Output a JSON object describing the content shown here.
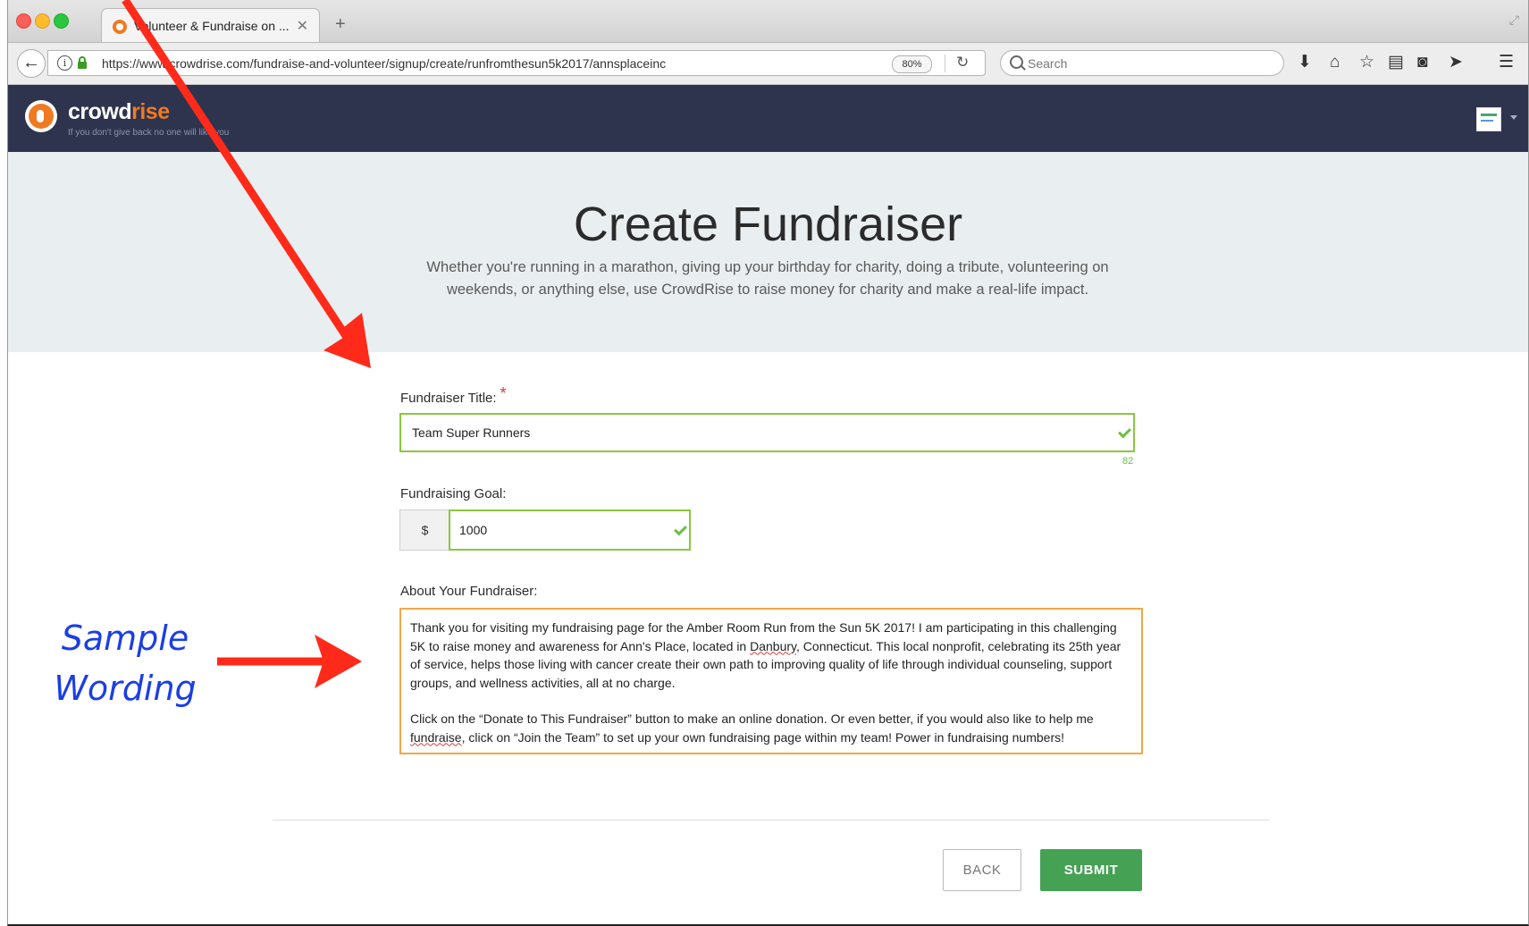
{
  "browser": {
    "tab_title": "Volunteer & Fundraise on ...",
    "url": "https://www.crowdrise.com/fundraise-and-volunteer/signup/create/runfromthesun5k2017/annsplaceinc",
    "zoom": "80%",
    "search_placeholder": "Search",
    "new_tab": "+",
    "tab_close": "✕"
  },
  "site": {
    "logo_part1": "crowd",
    "logo_part2": "rise",
    "tagline": "If you don't give back no one will like you"
  },
  "hero": {
    "title": "Create Fundraiser",
    "subtitle": "Whether you're running in a marathon, giving up your birthday for charity, doing a tribute, volunteering on weekends, or anything else, use CrowdRise to raise money for charity and make a real-life impact."
  },
  "form": {
    "title_label": "Fundraiser Title:",
    "required_mark": "*",
    "title_value": "Team Super Runners",
    "title_counter": "82",
    "goal_label": "Fundraising Goal:",
    "currency": "$",
    "goal_value": "1000",
    "about_label": "About Your Fundraiser:",
    "about_p1a": "Thank you for visiting my fundraising page for the Amber Room Run from the Sun 5K 2017! I am participating in this challenging 5K to raise money and awareness for Ann's Place, located in ",
    "about_p1_spell": "Danbury",
    "about_p1b": ", Connecticut. This local nonprofit, celebrating its 25th year of service, helps those living with cancer create their own path to improving quality of life through individual counseling, support groups, and wellness activities, all at no charge.",
    "about_p2a": "Click on the “Donate to This Fundraiser” button to make an online donation. Or even better, if you would also like to help me ",
    "about_p2_spell": "fundraise",
    "about_p2b": ", click on “Join the Team” to set up your own fundraising page within my team! Power in fundraising numbers!",
    "back_label": "BACK",
    "submit_label": "SUBMIT"
  },
  "annotation": {
    "line1": "Sample",
    "line2": "Wording",
    "arrow_color": "#ff2a1a",
    "text_color": "#1a3ee6"
  },
  "colors": {
    "header_bg": "#2e344d",
    "brand_orange": "#f07a22",
    "valid_green": "#8cc63f",
    "submit_green": "#45a154",
    "focus_orange": "#f0a848"
  }
}
